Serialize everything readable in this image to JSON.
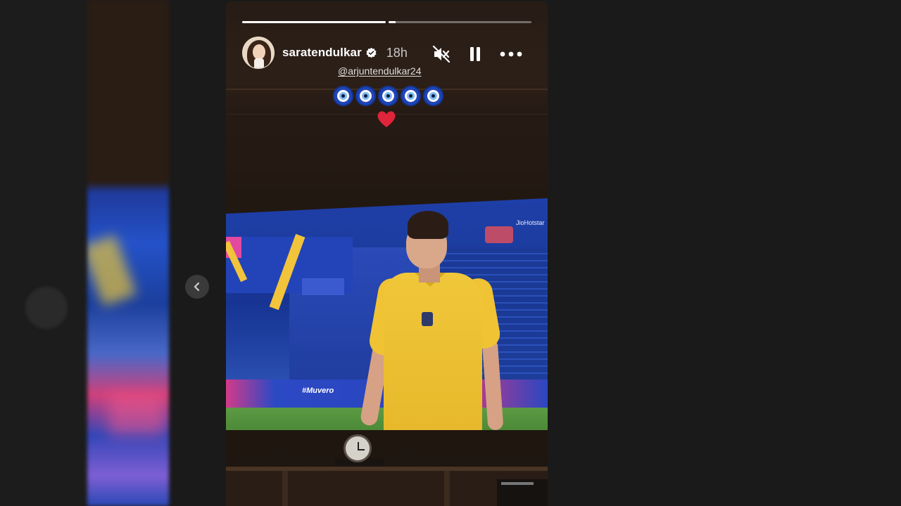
{
  "story": {
    "progress": [
      1.0,
      0.05
    ],
    "username": "saratendulkar",
    "time_ago": "18h",
    "mention": "@arjuntendulkar24",
    "emoji_eyes_count": 5,
    "emoji_heart": "❤️",
    "icons": {
      "verified": "verified-badge-icon",
      "mute": "muted-speaker-icon",
      "pause": "pause-icon",
      "more": "more-options-icon",
      "previous": "chevron-left-icon"
    },
    "broadcast": {
      "channel": "JioHotstar",
      "ad_text": "#Muvero"
    }
  },
  "colors": {
    "background": "#1a1a1a",
    "nav_button": "#3a3a3a",
    "eye_blue": "#1f45b8",
    "heart": "#e0243a",
    "jersey": "#f1c73a"
  }
}
